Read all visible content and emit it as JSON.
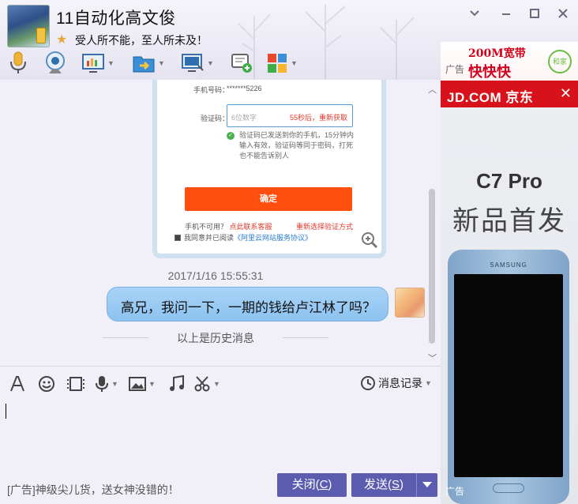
{
  "header": {
    "name": "11自动化高文俊",
    "signature": "受人所不能，至人所未及！",
    "window_buttons": [
      "minimize",
      "maximize",
      "close"
    ]
  },
  "toolbar_icons": [
    "microphone-icon",
    "video-camera-icon",
    "screen-share-icon",
    "file-transfer-icon",
    "remote-assist-icon",
    "new-chat-icon",
    "apps-icon"
  ],
  "chat": {
    "screenshot_content": {
      "phone_label": "手机号码：",
      "phone_value": "*******5226",
      "code_label": "验证码：",
      "code_placeholder": "6位数字",
      "countdown": "55秒后，重新获取",
      "hint": "验证码已发送到你的手机，15分钟内输入有效，验证码等同于密码，打死也不能告诉别人",
      "confirm": "确定",
      "unavailable": "手机不可用？",
      "contact": "点此联系客服",
      "reselect": "重新选择验证方式",
      "agree_prefix": "我同意并已阅读",
      "agree_link": "《阿里云网站服务协议》"
    },
    "timestamp": "2017/1/16 15:55:31",
    "message": "高兄，我问一下，一期的钱给卢江林了吗？",
    "history_divider": "以上是历史消息"
  },
  "input_toolbar": {
    "icons": [
      "font-icon",
      "emoji-icon",
      "gif-icon",
      "voice-icon",
      "image-icon",
      "music-icon",
      "screenshot-icon"
    ],
    "history_label": "消息记录"
  },
  "footer": {
    "ad_text": "[广告]神级尖儿货，送女神没错的！",
    "close_label": "关闭(",
    "close_key": "C",
    "send_label": "发送(",
    "send_key": "S",
    "paren": ")"
  },
  "ad": {
    "top_label": "广告",
    "top_line1": "200M宽带",
    "top_line2": "快快快",
    "top_logo": "和家",
    "jd_brand": "JD.COM 京东",
    "jd_close": "✕",
    "model": "C7 Pro",
    "slogan": "新品首发",
    "phone_brand": "SAMSUNG",
    "bottom_label": "广告"
  }
}
